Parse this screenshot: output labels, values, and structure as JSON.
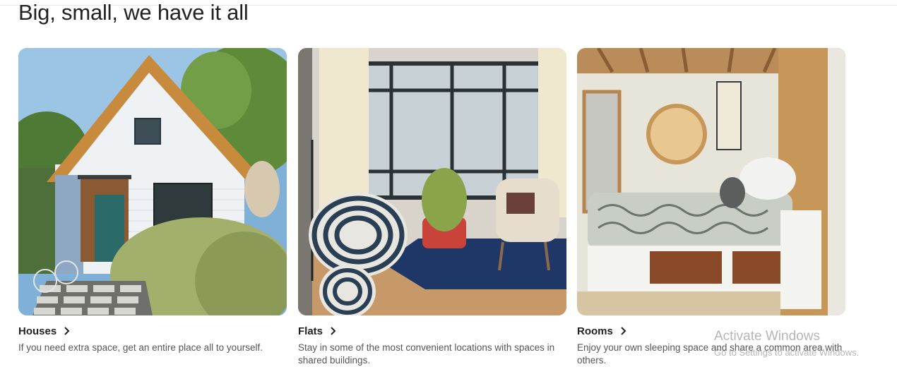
{
  "section": {
    "title": "Big, small, we have it all"
  },
  "cards": [
    {
      "title": "Houses",
      "description": "If you need extra space, get an entire place all to yourself.",
      "image_alt": "house-photo"
    },
    {
      "title": "Flats",
      "description": "Stay in some of the most convenient locations with spaces in shared buildings.",
      "image_alt": "flat-photo"
    },
    {
      "title": "Rooms",
      "description": "Enjoy your own sleeping space and share a common area with others.",
      "image_alt": "room-photo"
    }
  ],
  "watermark": {
    "line1": "Activate Windows",
    "line2": "Go to Settings to activate Windows."
  },
  "icons": {
    "chevron": "chevron-right-icon"
  }
}
